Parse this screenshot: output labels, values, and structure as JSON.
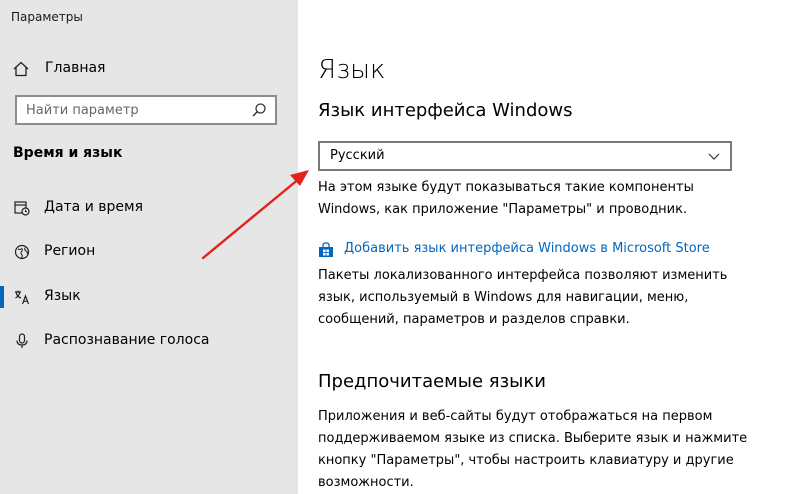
{
  "window": {
    "title": "Параметры"
  },
  "sidebar": {
    "home_label": "Главная",
    "search": {
      "placeholder": "Найти параметр"
    },
    "section_heading": "Время и язык",
    "items": [
      {
        "label": "Дата и время",
        "icon": "calendar-clock-icon",
        "selected": false
      },
      {
        "label": "Регион",
        "icon": "globe-icon",
        "selected": false
      },
      {
        "label": "Язык",
        "icon": "language-icon",
        "selected": true
      },
      {
        "label": "Распознавание голоса",
        "icon": "microphone-icon",
        "selected": false
      }
    ]
  },
  "main": {
    "title": "Язык",
    "display_language": {
      "heading": "Язык интерфейса Windows",
      "selected": "Русский",
      "description": "На этом языке будут показываться такие компоненты Windows, как приложение \"Параметры\" и проводник."
    },
    "store_link": {
      "label": "Добавить язык интерфейса Windows в Microsoft Store",
      "icon": "store-icon"
    },
    "packs_description": "Пакеты локализованного интерфейса позволяют изменить язык, используемый в Windows для навигации, меню, сообщений, параметров и разделов справки.",
    "preferred": {
      "heading": "Предпочитаемые языки",
      "description": "Приложения и веб-сайты будут отображаться на первом поддерживаемом языке из списка. Выберите язык и нажмите кнопку \"Параметры\", чтобы настроить клавиатуру и другие возможности."
    }
  },
  "colors": {
    "sidebar_bg": "#e6e6e6",
    "accent": "#0067c0",
    "annotation_arrow": "#e2231a"
  }
}
